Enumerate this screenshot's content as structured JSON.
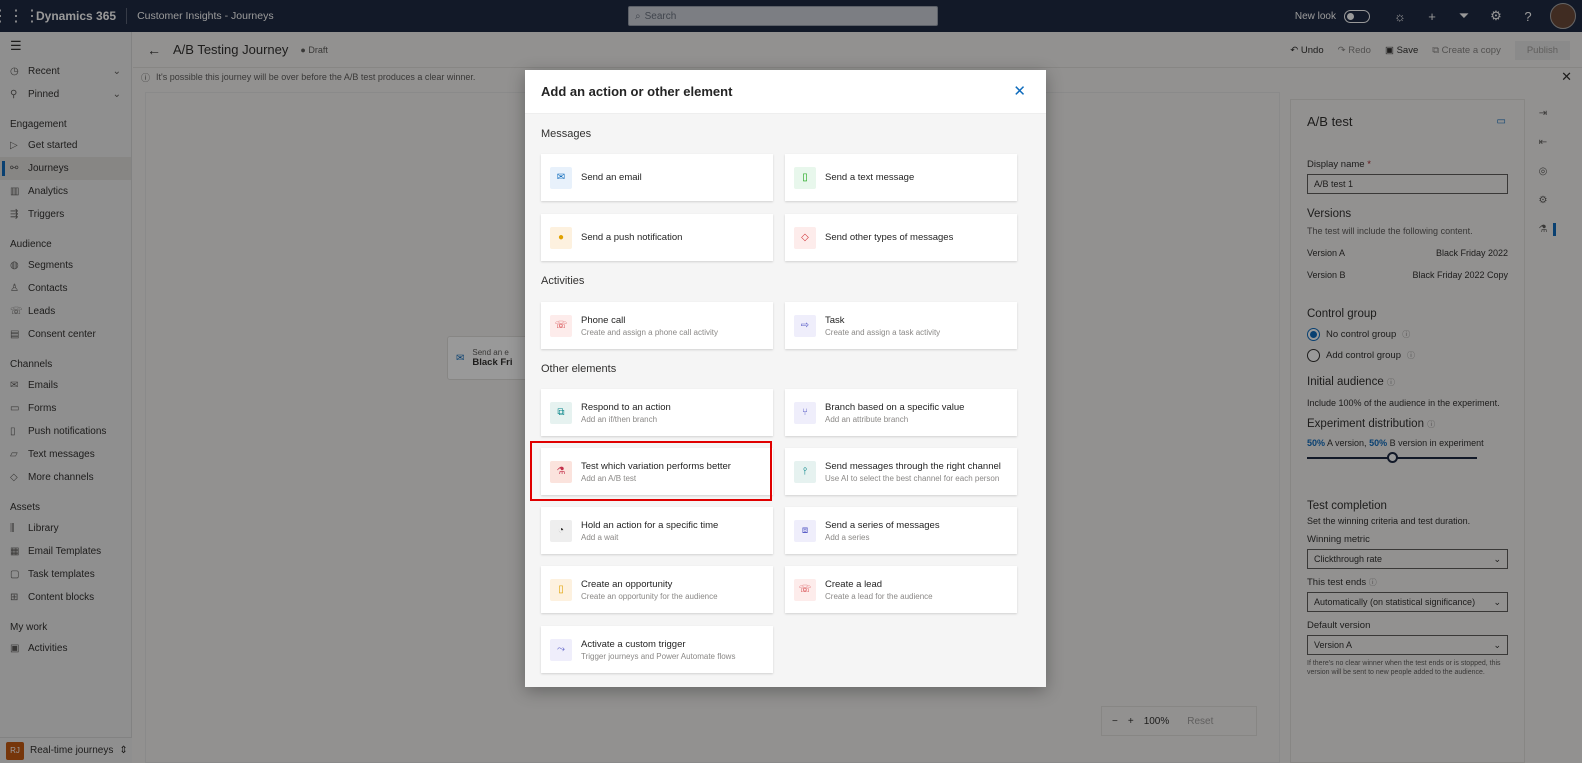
{
  "topbar": {
    "brand": "Dynamics 365",
    "app": "Customer Insights - Journeys",
    "search_placeholder": "Search",
    "new_look": "New look"
  },
  "sidebar": {
    "recent": "Recent",
    "pinned": "Pinned",
    "engagement": "Engagement",
    "get_started": "Get started",
    "journeys": "Journeys",
    "analytics": "Analytics",
    "triggers": "Triggers",
    "audience": "Audience",
    "segments": "Segments",
    "contacts": "Contacts",
    "leads": "Leads",
    "consent_center": "Consent center",
    "channels": "Channels",
    "emails": "Emails",
    "forms": "Forms",
    "push_notifications": "Push notifications",
    "text_messages": "Text messages",
    "more_channels": "More channels",
    "assets": "Assets",
    "library": "Library",
    "email_templates": "Email Templates",
    "task_templates": "Task templates",
    "content_blocks": "Content blocks",
    "my_work": "My work",
    "activities": "Activities",
    "area_badge": "RJ",
    "area": "Real-time journeys"
  },
  "command": {
    "title": "A/B Testing Journey",
    "status": "Draft",
    "undo": "Undo",
    "redo": "Redo",
    "save": "Save",
    "copy": "Create a copy",
    "publish": "Publish"
  },
  "warning": "It's possible this journey will be over before the A/B test produces a clear winner.",
  "canvas": {
    "node_line1": "Send an e",
    "node_line2": "Black Fri",
    "zoom": "100%",
    "reset": "Reset"
  },
  "panel": {
    "title": "A/B test",
    "display_name_label": "Display name",
    "required": "*",
    "display_name": "A/B test 1",
    "versions_head": "Versions",
    "versions_text": "The test will include the following content.",
    "version_a_label": "Version A",
    "version_a": "Black Friday 2022",
    "version_b_label": "Version B",
    "version_b": "Black Friday 2022 Copy",
    "control_head": "Control group",
    "no_control": "No control group",
    "add_control": "Add control group",
    "initial_head": "Initial audience",
    "initial_text": "Include 100% of the audience in the experiment.",
    "dist_head": "Experiment distribution",
    "dist_a_pct": "50%",
    "dist_a": "A version,",
    "dist_b_pct": "50%",
    "dist_b": "B version in experiment",
    "dist_value": 0.5,
    "completion_head": "Test completion",
    "completion_text": "Set the winning criteria and test duration.",
    "metric_label": "Winning metric",
    "metric": "Clickthrough rate",
    "ends_label": "This test ends",
    "ends": "Automatically (on statistical significance)",
    "default_label": "Default version",
    "default": "Version A",
    "default_note": "If there's no clear winner when the test ends or is stopped, this version will be sent to new people added to the audience."
  },
  "dialog": {
    "title": "Add an action or other element",
    "messages": "Messages",
    "activities": "Activities",
    "other": "Other elements",
    "cards": [
      {
        "t": "Send an email",
        "s": ""
      },
      {
        "t": "Send a text message",
        "s": ""
      },
      {
        "t": "Send a push notification",
        "s": ""
      },
      {
        "t": "Send other types of messages",
        "s": ""
      },
      {
        "t": "Phone call",
        "s": "Create and assign a phone call activity"
      },
      {
        "t": "Task",
        "s": "Create and assign a task activity"
      },
      {
        "t": "Respond to an action",
        "s": "Add an if/then branch"
      },
      {
        "t": "Branch based on a specific value",
        "s": "Add an attribute branch"
      },
      {
        "t": "Test which variation performs better",
        "s": "Add an A/B test"
      },
      {
        "t": "Send messages through the right channel",
        "s": "Use AI to select the best channel for each person"
      },
      {
        "t": "Hold an action for a specific time",
        "s": "Add a wait"
      },
      {
        "t": "Send a series of messages",
        "s": "Add a series"
      },
      {
        "t": "Create an opportunity",
        "s": "Create an opportunity for the audience"
      },
      {
        "t": "Create a lead",
        "s": "Create a lead for the audience"
      },
      {
        "t": "Activate a custom trigger",
        "s": "Trigger journeys and Power Automate flows"
      }
    ]
  },
  "colors": {
    "accent": "#0f6cbd",
    "topbar": "#1f2a44",
    "highlight": "#e00000"
  }
}
